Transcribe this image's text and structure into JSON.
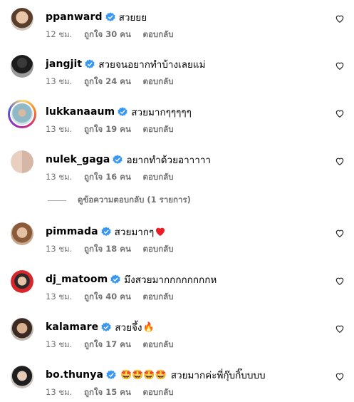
{
  "icons": {
    "verified": "verified-badge-icon",
    "like": "heart-outline-icon"
  },
  "colors": {
    "verified": "#3897f0",
    "meta": "#737373",
    "ring": "#d62976",
    "heart_emoji": "#ed1c24"
  },
  "comments": [
    {
      "username": "ppanward",
      "text": "สวยยย",
      "emoji": "",
      "time": "12 ชม.",
      "likes": "ถูกใจ 30 คน",
      "reply": "ตอบกลับ"
    },
    {
      "username": "jangjit",
      "text": "สวยจนอยากทำบ้างเลยแม่",
      "emoji": "",
      "time": "13 ชม.",
      "likes": "ถูกใจ 24 คน",
      "reply": "ตอบกลับ"
    },
    {
      "username": "lukkanaaum",
      "text": "สวยมากๆๆๆๆๆ",
      "emoji": "",
      "time": "13 ชม.",
      "likes": "ถูกใจ 19 คน",
      "reply": "ตอบกลับ"
    },
    {
      "username": "nulek_gaga",
      "text": "อยากทำด้วยอาาาาา",
      "emoji": "",
      "time": "13 ชม.",
      "likes": "ถูกใจ 16 คน",
      "reply": "ตอบกลับ"
    },
    {
      "username": "pimmada",
      "text": "สวยมากๆ",
      "emoji": "❤️",
      "time": "13 ชม.",
      "likes": "ถูกใจ 18 คน",
      "reply": "ตอบกลับ"
    },
    {
      "username": "dj_matoom",
      "text": "มึงสวยมากกกกกกกกห",
      "emoji": "",
      "time": "13 ชม.",
      "likes": "ถูกใจ 40 คน",
      "reply": "ตอบกลับ"
    },
    {
      "username": "kalamare",
      "text": "สวยจึ้ง",
      "emoji": "🔥",
      "time": "13 ชม.",
      "likes": "ถูกใจ 17 คน",
      "reply": "ตอบกลับ"
    },
    {
      "username": "bo.thunya",
      "text": "สวยมากค่ะพี่กุ๊บกิ๊บบบบ",
      "emoji": "🤩🤩🤩🤩",
      "time": "13 ชม.",
      "likes": "ถูกใจ 15 คน",
      "reply": "ตอบกลับ"
    }
  ],
  "view_replies": "ดูข้อความตอบกลับ (1 รายการ)"
}
